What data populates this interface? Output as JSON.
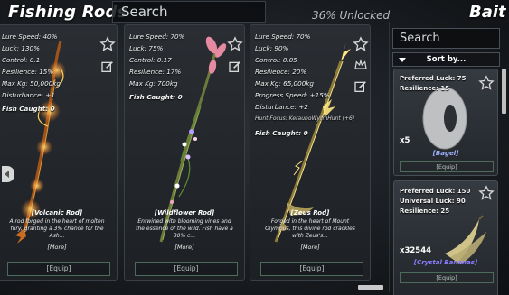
{
  "header": {
    "title": "Fishing Rods",
    "search_placeholder": "Search",
    "unlocked": "36% Unlocked",
    "bait_title": "Bait"
  },
  "rods": [
    {
      "name": "[Volcanic Rod]",
      "stats": [
        "Lure Speed: 40%",
        "Luck: 130%",
        "Control: 0.1",
        "Resilience: 15%",
        "Max Kg: 50,000kg",
        "Disturbance: +1"
      ],
      "caught": "Fish Caught: 0",
      "description": "A rod forged in the heart of molten fury, granting a 3% chance for the Ash...",
      "more": "[More]",
      "equip": "[Equip]"
    },
    {
      "name": "[Wildflower Rod]",
      "stats": [
        "Lure Speed: 70%",
        "Luck: 75%",
        "Control: 0.17",
        "Resilience: 17%",
        "Max Kg: 700kg"
      ],
      "caught": "Fish Caught: 0",
      "description": "Entwined with blooming vines and the essence of the wild. Fish have a 30% c...",
      "more": "[More]",
      "equip": "[Equip]"
    },
    {
      "name": "[Zeus Rod]",
      "stats": [
        "Lure Speed: 70%",
        "Luck: 90%",
        "Control: 0.05",
        "Resilience: 20%",
        "Max Kg: 65,000kg",
        "Progress Speed: +15%",
        "Disturbance: +2"
      ],
      "hunt_focus": "Hunt Focus: KeraunoWyrmHunt (+6)",
      "caught": "Fish Caught: 0",
      "description": "Forged in the heart of Mount Olympus, this divine rod crackles with Zeus's...",
      "more": "[More]",
      "equip": "[Equip]"
    }
  ],
  "bait_panel": {
    "search_placeholder": "Search",
    "sort_label": "Sort by...",
    "items": [
      {
        "stats": [
          "Preferred Luck: 75",
          "Resilience: 15"
        ],
        "count": "x5",
        "name": "[Bagel]",
        "name_color": "#9fb3ff",
        "equip": "[Equip]"
      },
      {
        "stats": [
          "Preferred Luck: 150",
          "Universal Luck: 90",
          "Resilience: 25"
        ],
        "count": "x32544",
        "name": "[Crystal Bananas]",
        "name_color": "#8a7dff",
        "equip": "[Equip]"
      }
    ]
  },
  "icons": [
    "star-icon",
    "edit-icon",
    "crown-icon",
    "chevron-left-icon",
    "sort-arrow-icon"
  ]
}
